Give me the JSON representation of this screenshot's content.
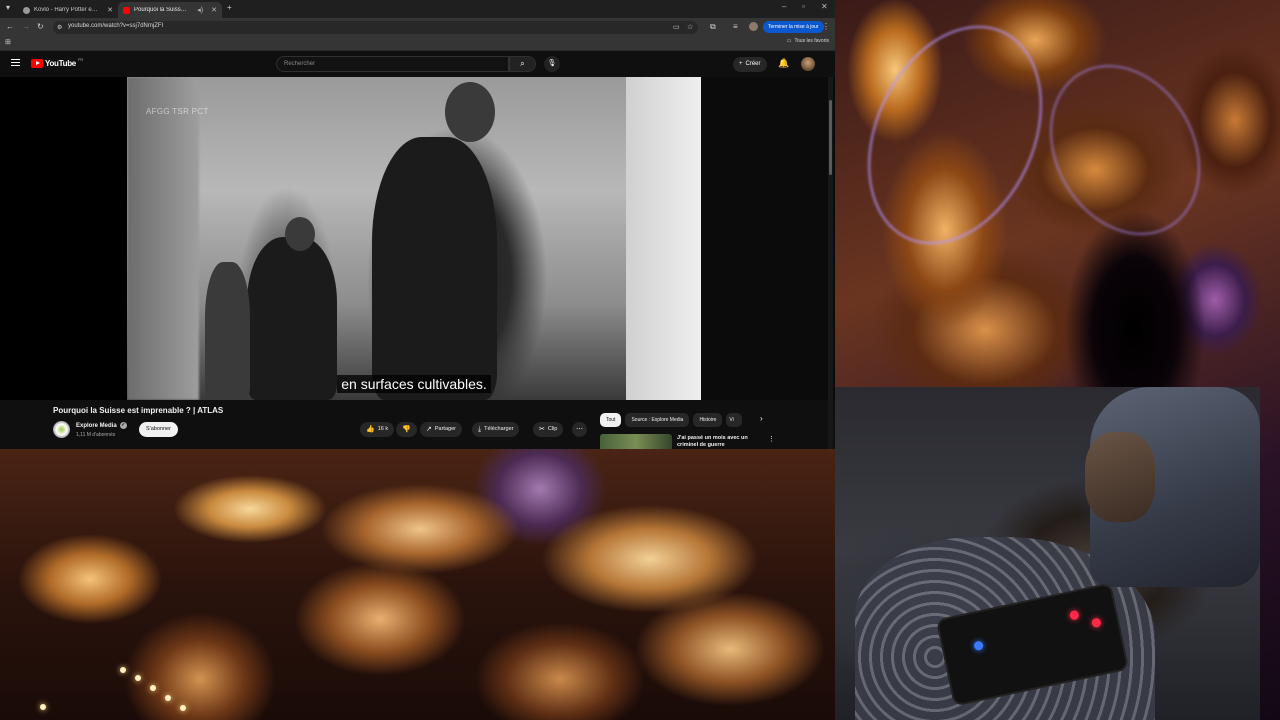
{
  "browser": {
    "tabs": [
      {
        "title": "Kovlo - Harry Potter et le Prisonnier",
        "favicon_color": "#9a9a9a",
        "active": false
      },
      {
        "title": "Pourquoi la Suisse est imprenable",
        "favicon_color": "#ff0000",
        "active": true
      }
    ],
    "new_tab_glyph": "+",
    "url": "youtube.com/watch?v=ssj7dNmjZFI",
    "update_label": "Terminer la mise à jour",
    "bookmarks_folder": "Tous les favoris"
  },
  "youtube": {
    "wordmark": "YouTube",
    "country": "FR",
    "search_placeholder": "Rechercher",
    "create_label": "Créer",
    "player": {
      "watermark": "AFGG TSR PCT",
      "subtitle": "en surfaces cultivables."
    },
    "video": {
      "title": "Pourquoi la Suisse est imprenable ? | ATLAS",
      "channel": "Explore Media",
      "subscribers": "1,11 M d'abonnés",
      "subscribe_label": "S'abonner",
      "likes": "16 k",
      "share_label": "Partager",
      "download_label": "Télécharger",
      "clip_label": "Clip"
    },
    "chips": [
      "Tout",
      "Source : Explore Media",
      "Histoire",
      "Vi"
    ],
    "recommendation": {
      "title": "J'ai passé un mois avec un criminel de guerre"
    }
  },
  "colors": {
    "yt_red": "#ff0000",
    "update_blue": "#0b57d0",
    "dark_bg": "#0f0f0f"
  }
}
